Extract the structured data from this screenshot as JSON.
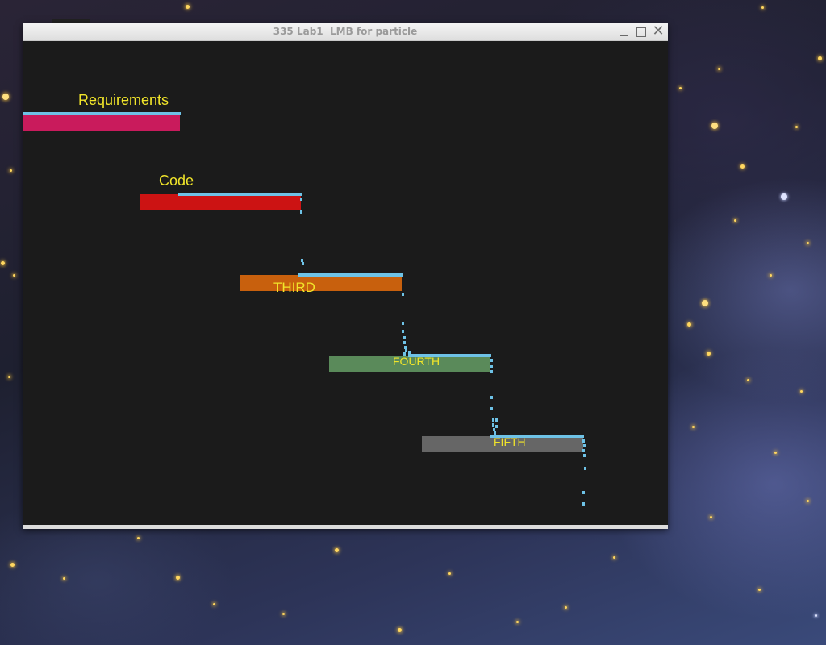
{
  "window": {
    "title": "335 Lab1  LMB for particle",
    "close_glyph": "✕"
  },
  "tasks": [
    {
      "label": "Requirements",
      "color": "#c91b5c",
      "progress": 1.0
    },
    {
      "label": "Code",
      "color": "#cc1313",
      "progress": 0.76
    },
    {
      "label": "THIRD",
      "color": "#c8600d",
      "progress": 0.64
    },
    {
      "label": "FOURTH",
      "color": "#5a8a5a",
      "progress": 0.49
    },
    {
      "label": "FIFTH",
      "color": "#666666",
      "progress": 0.58
    }
  ],
  "colors": {
    "progress": "#6ec2e6",
    "label": "#f1e52a",
    "canvas": "#1b1b1b"
  }
}
